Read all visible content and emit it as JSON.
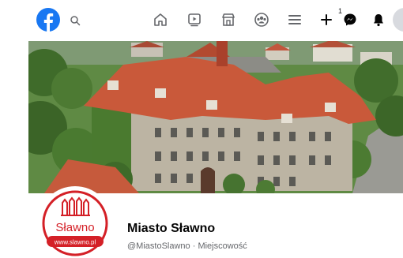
{
  "nav": {
    "notification_count": "1",
    "icons": [
      "facebook-logo-icon",
      "search-icon",
      "home-icon",
      "watch-icon",
      "marketplace-icon",
      "groups-icon",
      "menu-icon",
      "plus-icon",
      "messenger-icon",
      "bell-icon",
      "avatar"
    ]
  },
  "cover": {
    "description_colors": {
      "roof": "#c9593a",
      "wall": "#bfb8a8",
      "trees": "#4f7d35"
    }
  },
  "page": {
    "name": "Miasto Sławno",
    "handle": "@MiastoSlawno",
    "separator": " · ",
    "category": "Miejscowość"
  },
  "logo": {
    "text": "Sławno",
    "url": "www.slawno.pl",
    "color": "#d42027"
  },
  "colors": {
    "brand": "#1877f2",
    "text_primary": "#050505",
    "text_secondary": "#65676b"
  }
}
